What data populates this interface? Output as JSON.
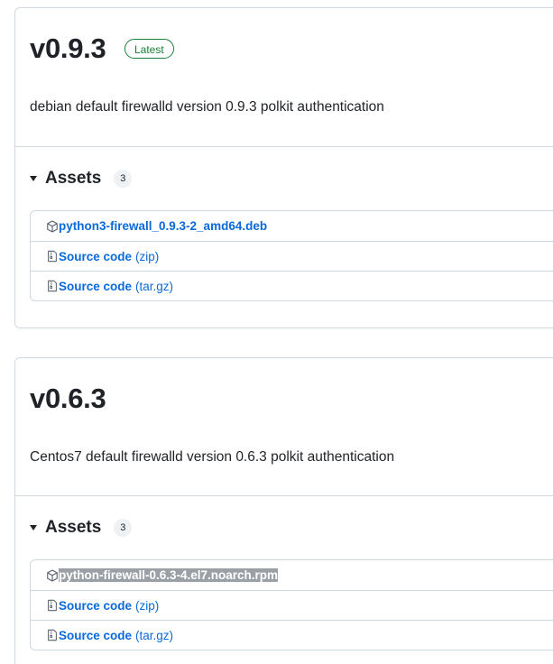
{
  "releases": [
    {
      "tag": "v0.9.3",
      "badge": "Latest",
      "description": "debian default firewalld version 0.9.3 polkit authentication",
      "assets_label": "Assets",
      "assets_count": "3",
      "assets": [
        {
          "name": "python3-firewall_0.9.3-2_amd64.deb",
          "ext": "",
          "icon": "package-icon"
        },
        {
          "name": "Source code",
          "ext": "(zip)",
          "icon": "file-zip-icon"
        },
        {
          "name": "Source code",
          "ext": "(tar.gz)",
          "icon": "file-zip-icon"
        }
      ]
    },
    {
      "tag": "v0.6.3",
      "description": "Centos7 default firewalld version 0.6.3 polkit authentication",
      "assets_label": "Assets",
      "assets_count": "3",
      "assets": [
        {
          "name": "python-firewall-0.6.3-4.el7.noarch.rpm",
          "ext": "",
          "icon": "package-icon",
          "selected": true
        },
        {
          "name": "Source code",
          "ext": "(zip)",
          "icon": "file-zip-icon"
        },
        {
          "name": "Source code",
          "ext": "(tar.gz)",
          "icon": "file-zip-icon"
        }
      ]
    }
  ],
  "colors": {
    "link": "#0969da",
    "latest_badge": "#1a7f37",
    "border": "#d1d9e0",
    "selection": "#9aa0a6"
  }
}
